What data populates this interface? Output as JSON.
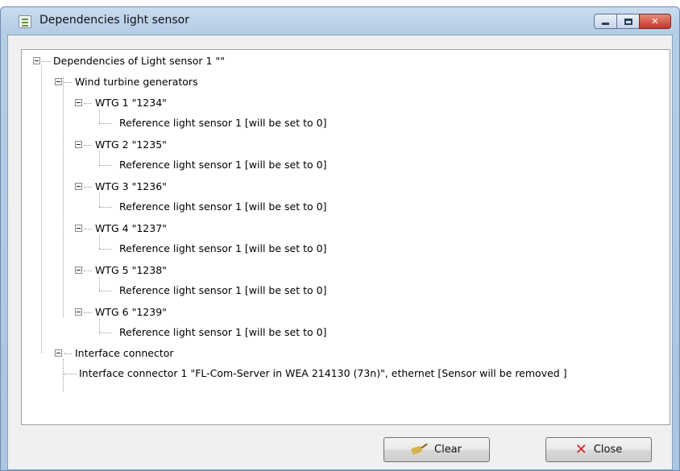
{
  "window": {
    "title": "Dependencies light sensor",
    "icon": "checklist-icon"
  },
  "tree": {
    "root": {
      "label": "Dependencies of Light sensor 1 \"\""
    },
    "group_wtg": {
      "label": "Wind turbine generators"
    },
    "wtg": [
      {
        "label": "WTG 1 \"1234\"",
        "child": "Reference light sensor 1 [will be set to 0]"
      },
      {
        "label": "WTG 2 \"1235\"",
        "child": "Reference light sensor 1 [will be set to 0]"
      },
      {
        "label": "WTG 3 \"1236\"",
        "child": "Reference light sensor 1 [will be set to 0]"
      },
      {
        "label": "WTG 4 \"1237\"",
        "child": "Reference light sensor 1 [will be set to 0]"
      },
      {
        "label": "WTG 5 \"1238\"",
        "child": "Reference light sensor 1 [will be set to 0]"
      },
      {
        "label": "WTG 6 \"1239\"",
        "child": "Reference light sensor 1 [will be set to 0]"
      }
    ],
    "group_interface": {
      "label": "Interface connector"
    },
    "interface_child": "Interface connector 1 \"FL-Com-Server in WEA 214130 (73n)\", ethernet [Sensor will be removed ]"
  },
  "buttons": {
    "clear_label": "Clear",
    "close_label": "Close"
  }
}
